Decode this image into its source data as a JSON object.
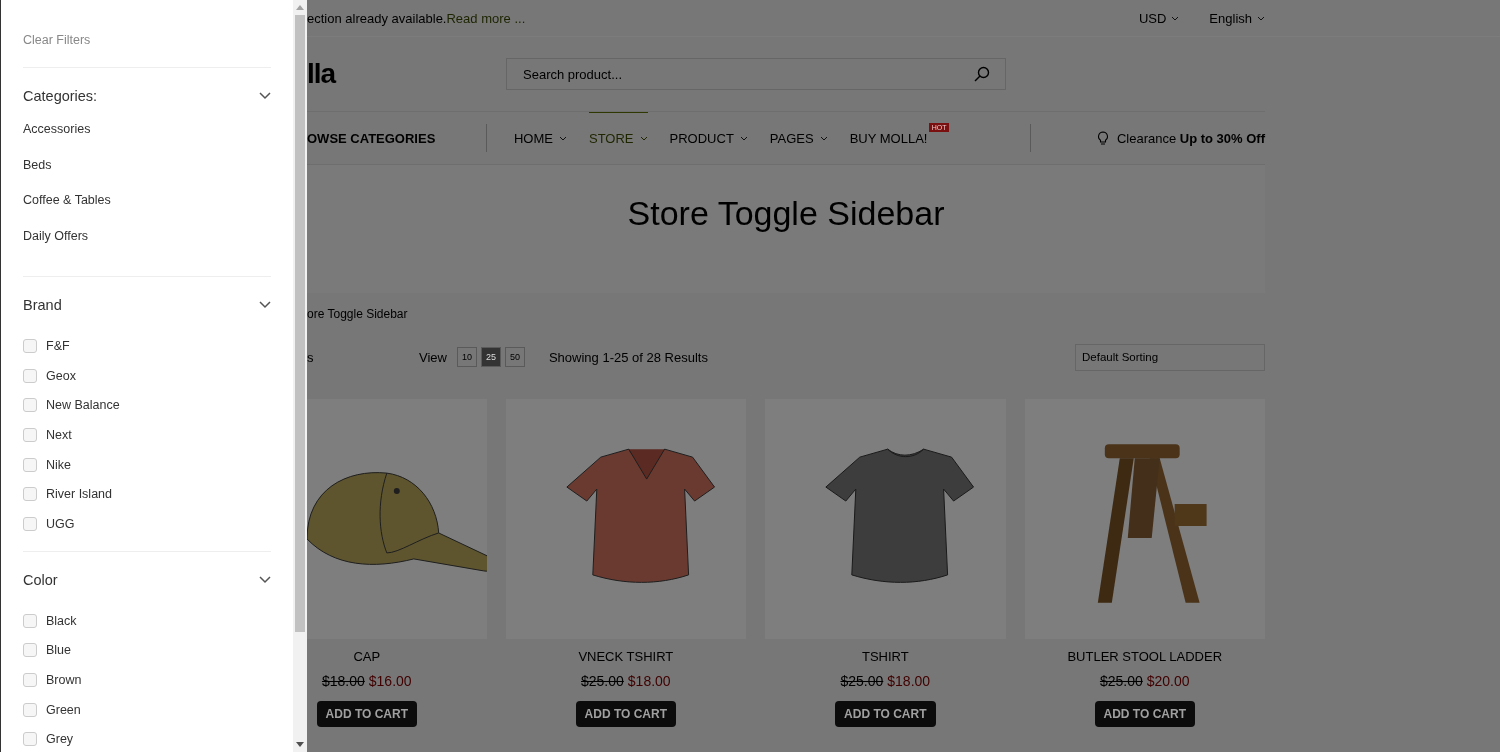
{
  "sidebar": {
    "clear_filters": "Clear Filters",
    "sections": [
      {
        "title": "Categories:",
        "expanded": true,
        "kind": "links",
        "items": [
          {
            "label": "Accessories"
          },
          {
            "label": "Beds"
          },
          {
            "label": "Coffee & Tables"
          },
          {
            "label": "Daily Offers"
          }
        ]
      },
      {
        "title": "Brand",
        "expanded": true,
        "kind": "checkboxes",
        "items": [
          {
            "label": "F&F",
            "checked": false
          },
          {
            "label": "Geox",
            "checked": false
          },
          {
            "label": "New Balance",
            "checked": false
          },
          {
            "label": "Next",
            "checked": false
          },
          {
            "label": "Nike",
            "checked": false
          },
          {
            "label": "River Island",
            "checked": false
          },
          {
            "label": "UGG",
            "checked": false
          }
        ]
      },
      {
        "title": "Color",
        "expanded": true,
        "kind": "checkboxes",
        "items": [
          {
            "label": "Black",
            "checked": false
          },
          {
            "label": "Blue",
            "checked": false
          },
          {
            "label": "Brown",
            "checked": false
          },
          {
            "label": "Green",
            "checked": false
          },
          {
            "label": "Grey",
            "checked": false
          }
        ]
      }
    ]
  },
  "top_bar": {
    "notice": "ection already available.",
    "link": "Read more ...",
    "currency": "USD",
    "language": "English"
  },
  "header": {
    "logo": "lla",
    "search": {
      "placeholder": "Search product..."
    }
  },
  "nav": {
    "categories_label": "OWSE CATEGORIES",
    "items": [
      {
        "label": "HOME",
        "selected": false
      },
      {
        "label": "STORE",
        "selected": true
      },
      {
        "label": "PRODUCT",
        "selected": false
      },
      {
        "label": "PAGES",
        "selected": false
      },
      {
        "label": "BUY MOLLA!",
        "selected": false,
        "badge": "HOT"
      }
    ],
    "promo": "Clearance **Up to 30% Off**"
  },
  "page_title": "Store Toggle Sidebar",
  "breadcrumb": "ore Toggle Sidebar",
  "toolbar": {
    "label_fragment": "s",
    "view_label": "View",
    "view_options": [
      {
        "label": "10",
        "selected": false
      },
      {
        "label": "25",
        "selected": true
      },
      {
        "label": "50",
        "selected": false
      }
    ],
    "results": "Showing 1-25 of 28 Results",
    "sorting": "Default Sorting"
  },
  "products": [
    {
      "name": "CAP",
      "old_price": "$18.00",
      "price": "$16.00",
      "button": "ADD TO CART"
    },
    {
      "name": "VNECK TSHIRT",
      "old_price": "$25.00",
      "price": "$18.00",
      "button": "ADD TO CART"
    },
    {
      "name": "TSHIRT",
      "old_price": "$25.00",
      "price": "$18.00",
      "button": "ADD TO CART"
    },
    {
      "name": "BUTLER STOOL LADDER",
      "old_price": "$25.00",
      "price": "$20.00",
      "button": "ADD TO CART"
    }
  ]
}
